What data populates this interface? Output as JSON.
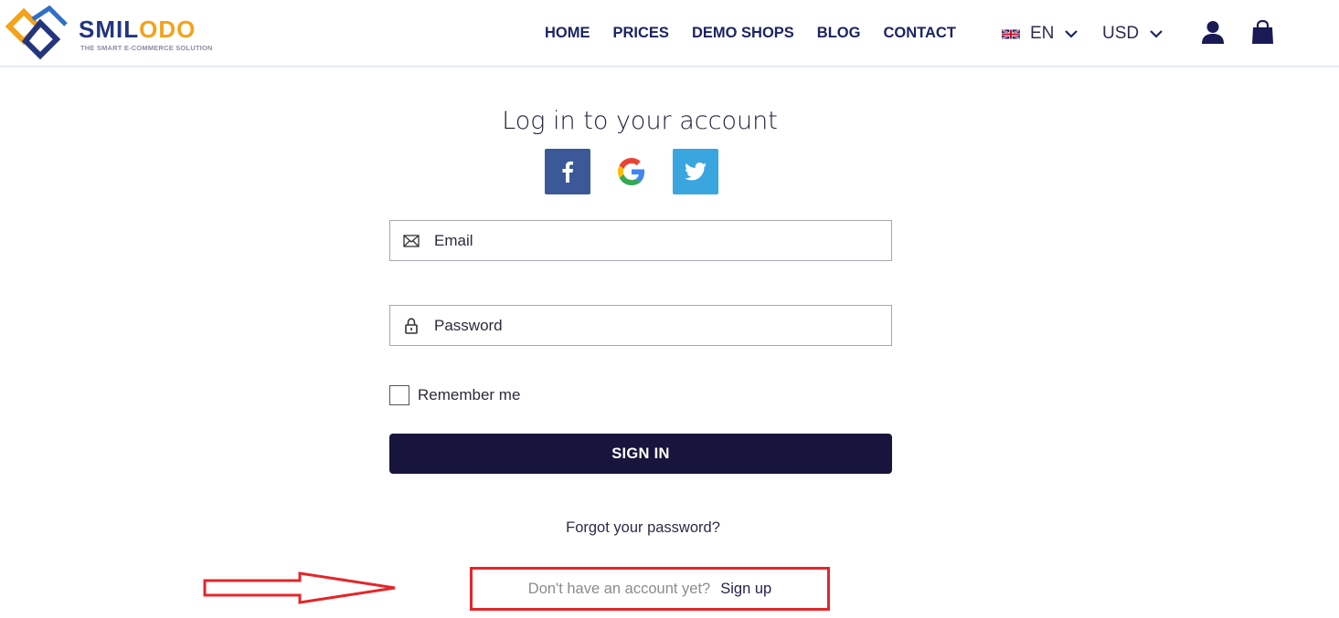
{
  "brand": {
    "name_part1": "SMIL",
    "name_part2": "ODO",
    "tagline": "THE SMART E-COMMERCE SOLUTION",
    "colors": {
      "navy": "#23357e",
      "orange": "#f4a21b"
    }
  },
  "nav": {
    "items": [
      {
        "label": "HOME"
      },
      {
        "label": "PRICES"
      },
      {
        "label": "DEMO SHOPS"
      },
      {
        "label": "BLOG"
      },
      {
        "label": "CONTACT"
      }
    ],
    "language": {
      "label": "EN",
      "icon": "uk-flag-icon"
    },
    "currency": {
      "label": "USD"
    },
    "account_icon": "user-icon",
    "cart_icon": "shopping-bag-icon"
  },
  "login": {
    "title": "Log in to your account",
    "social": [
      {
        "name": "facebook",
        "icon": "facebook-icon",
        "color": "#3b5998"
      },
      {
        "name": "google",
        "icon": "google-icon",
        "color": "#ffffff"
      },
      {
        "name": "twitter",
        "icon": "twitter-icon",
        "color": "#3aa6df"
      }
    ],
    "email": {
      "placeholder": "Email",
      "value": "",
      "icon": "envelope-icon"
    },
    "password": {
      "placeholder": "Password",
      "value": "",
      "icon": "lock-icon"
    },
    "remember_label": "Remember me",
    "remember_checked": false,
    "submit_label": "SIGN IN",
    "submit_color": "#17153b",
    "forgot_label": "Forgot your password?",
    "signup_question": "Don't have an account yet?",
    "signup_link": "Sign up"
  },
  "annotation": {
    "highlight_color": "#e3262a"
  }
}
